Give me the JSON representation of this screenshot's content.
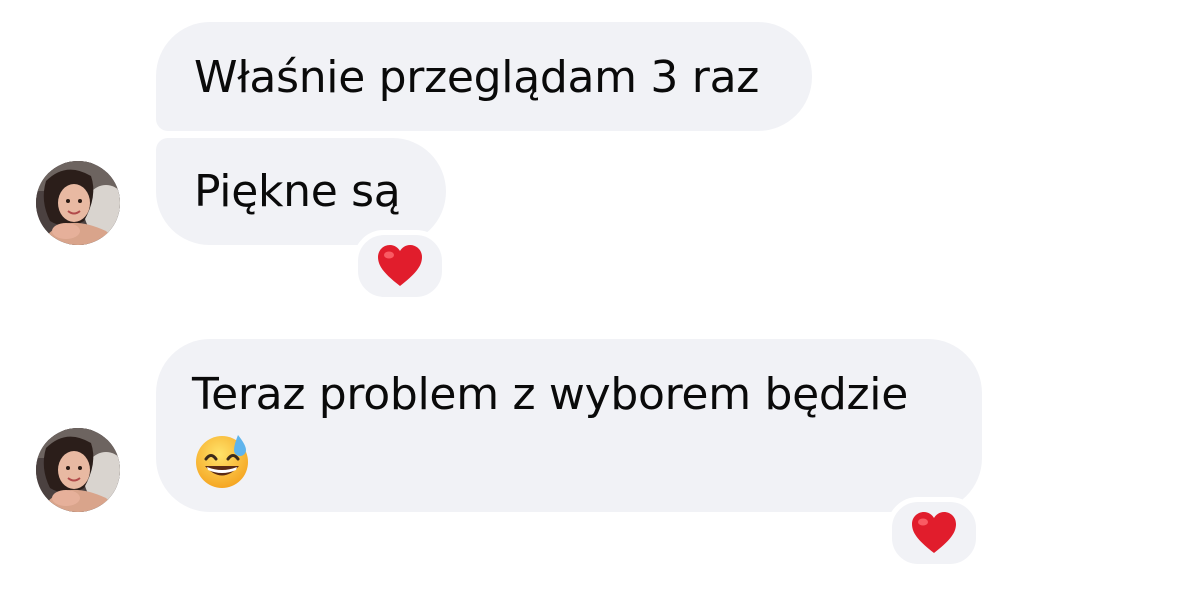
{
  "conversation": {
    "messages": [
      {
        "text": "Właśnie przeglądam 3 raz"
      },
      {
        "text": "Piękne są",
        "reaction": "heart-emoji"
      },
      {
        "text": "Teraz problem z wyborem będzie",
        "emoji": "grinning-sweat-emoji",
        "reaction": "heart-emoji"
      }
    ],
    "sender_avatar": "woman-portrait-avatar"
  },
  "colors": {
    "bubble_background": "#f1f2f6",
    "text": "#0a0a0a",
    "heart": "#e11d2c",
    "emoji_face": "#fcc21b",
    "sweat_drop": "#5fb4ec"
  }
}
